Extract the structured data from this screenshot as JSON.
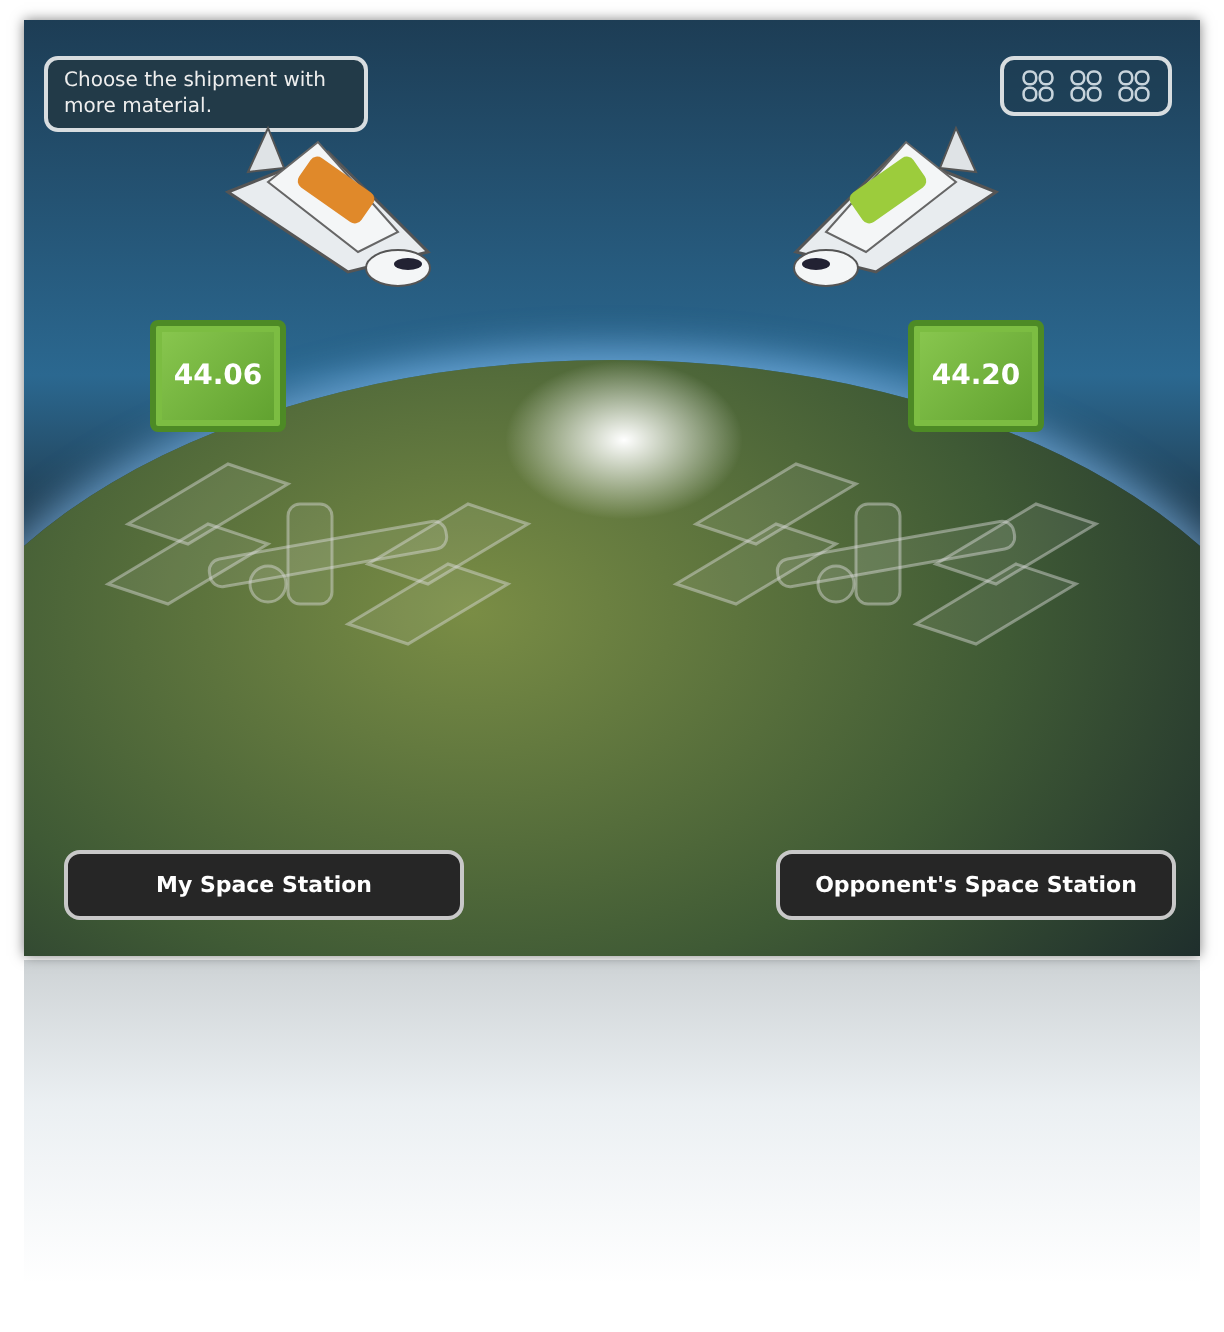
{
  "instruction": "Choose the shipment with more material.",
  "shipments": [
    {
      "color": "#e0892a",
      "amount": "44.06",
      "station_button": "My Space Station"
    },
    {
      "color": "#9ccc3c",
      "amount": "44.20",
      "station_button": "Opponent's Space Station"
    }
  ]
}
